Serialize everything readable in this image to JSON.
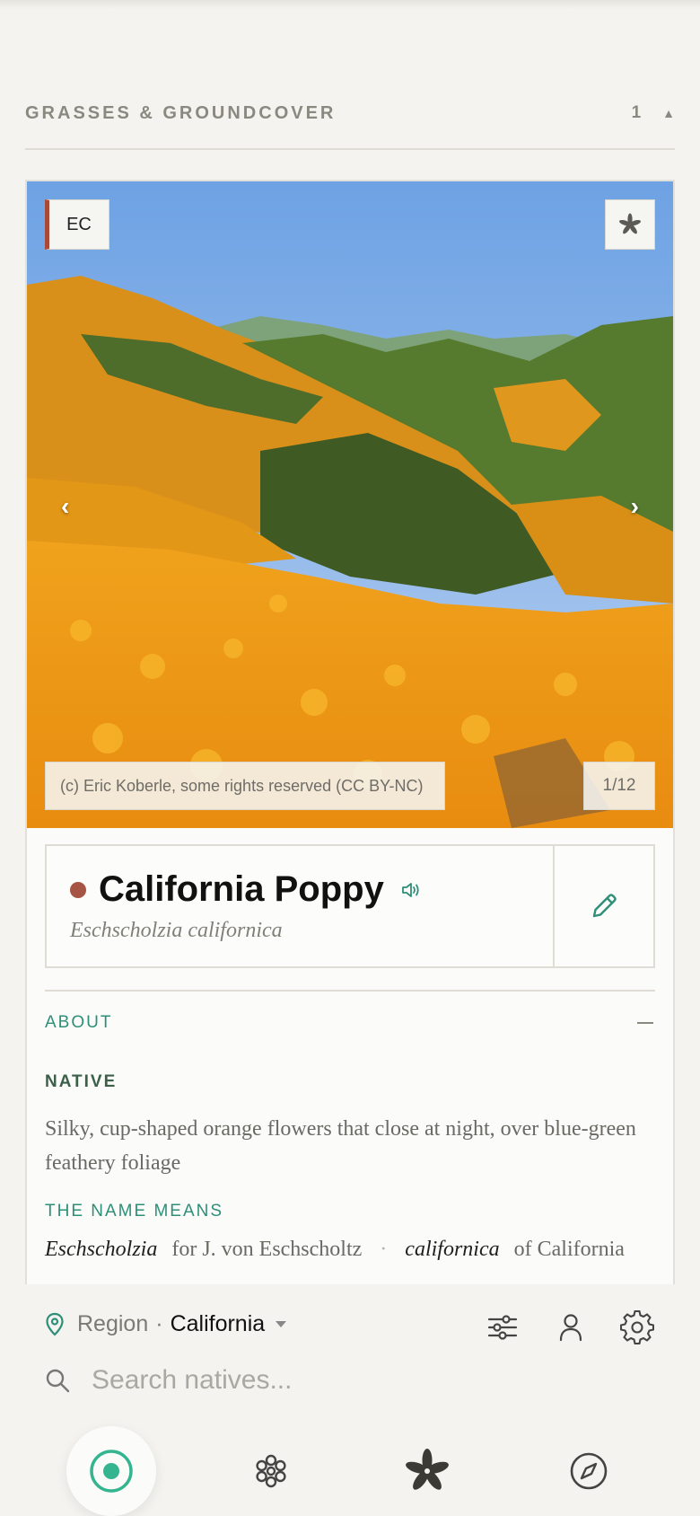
{
  "section": {
    "title": "GRASSES & GROUNDCOVER",
    "count": "1",
    "toggle_icon": "caret-up-icon"
  },
  "photo": {
    "badge": "EC",
    "badge_accent": "#a94a38",
    "credit": "(c) Eric Koberle, some rights reserved (CC BY-NC)",
    "counter": "1/12",
    "prev_icon": "chevron-left-icon",
    "next_icon": "chevron-right-icon"
  },
  "plant": {
    "common_name": "California Poppy",
    "scientific_name": "Eschscholzia californica",
    "status_color": "#a65443"
  },
  "about": {
    "label": "ABOUT",
    "native_label": "NATIVE",
    "description": "Silky, cup-shaped orange flowers that close at night, over blue-green feathery foliage",
    "name_means_label": "THE NAME MEANS",
    "etymology": [
      {
        "term": "Eschscholzia",
        "meaning": "for J. von Eschscholtz"
      },
      {
        "term": "californica",
        "meaning": "of California"
      }
    ],
    "separator": "·"
  },
  "region": {
    "label": "Region",
    "dot": "·",
    "value": "California"
  },
  "search": {
    "placeholder": "Search natives..."
  },
  "colors": {
    "accent": "#2e8f78",
    "native_heading": "#3b5f48",
    "background": "#f4f3ef"
  },
  "tabs": [
    "target-icon",
    "flower-outline-icon",
    "flower-filled-icon",
    "compass-icon"
  ]
}
